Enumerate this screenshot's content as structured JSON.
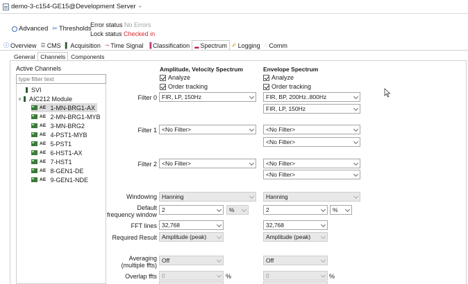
{
  "window": {
    "title": "demo-3-c154-GE15@Development Server",
    "close_glyph": "⌖"
  },
  "header": {
    "advanced_label": "Advanced",
    "thresholds_label": "Thresholds",
    "error_status_key": "Error status",
    "error_status_value": "No Errors",
    "lock_status_key": "Lock status",
    "lock_status_value": "Checked in",
    "lock_status_color": "#d9262c"
  },
  "main_tabs": [
    {
      "label": "Overview",
      "icon": "info-icon",
      "glyph": "ⓘ"
    },
    {
      "label": "CMS",
      "icon": "list-icon",
      "glyph": "☰"
    },
    {
      "label": "Acquisition",
      "icon": "acquisition-icon",
      "glyph": "▌"
    },
    {
      "label": "Time Signal",
      "icon": "time-signal-icon",
      "glyph": "⤳"
    },
    {
      "label": "Classification",
      "icon": "classification-icon",
      "glyph": "▐"
    },
    {
      "label": "Spectrum",
      "icon": "spectrum-icon",
      "glyph": "▂"
    },
    {
      "label": "Logging",
      "icon": "logging-icon",
      "glyph": "✐"
    },
    {
      "label": "Comm",
      "icon": "comm-icon",
      "glyph": "◌"
    }
  ],
  "sub_tabs": [
    "General",
    "Channels",
    "Components"
  ],
  "channels": {
    "label": "Active Channels",
    "filter_placeholder": "type filter text",
    "svi": "SVI",
    "module": "AIC212 Module",
    "ae_tag": "AE",
    "items": [
      "1-MN-BRG1-AX",
      "2-MN-BRG1-MYB",
      "3-MN-BRG2",
      "4-PST1-MYB",
      "5-PST1",
      "6-HST1-AX",
      "7-HST1",
      "8-GEN1-DE",
      "9-GEN1-NDE"
    ]
  },
  "columns": {
    "left_title": "Amplitude, Velocity Spectrum",
    "right_title": "Envelope Spectrum",
    "analyze": "Analyze",
    "order_tracking": "Order tracking"
  },
  "labels": {
    "filter0": "Filter 0",
    "filter1": "Filter 1",
    "filter2": "Filter 2",
    "windowing": "Windowing",
    "default_fw_1": "Default",
    "default_fw_2": "frequency window",
    "fft_lines": "FFT lines",
    "required_result": "Required Result",
    "averaging_1": "Averaging",
    "averaging_2": "(multiple ffts)",
    "overlap": "Overlap ffts"
  },
  "left": {
    "filter0": "FIR, LP, 150Hz",
    "filter1": "<No Filter>",
    "filter2": "<No Filter>",
    "windowing": "Hanning",
    "fw_value": "2",
    "fw_unit": "%",
    "fft_lines": "32,768",
    "required_result": "Amplitude (peak)",
    "averaging": "Off",
    "overlap": "0",
    "overlap_unit": "%"
  },
  "right": {
    "filter0a": "FIR, BP, 200Hz..800Hz",
    "filter0b": "FIR, LP, 150Hz",
    "filter1a": "<No Filter>",
    "filter1b": "<No Filter>",
    "filter2a": "<No Filter>",
    "filter2b": "<No Filter>",
    "windowing": "Hanning",
    "fw_value": "2",
    "fw_unit": "%",
    "fft_lines": "32,768",
    "required_result": "Amplitude (peak)",
    "averaging": "Off",
    "overlap": "0",
    "overlap_unit": "%"
  }
}
